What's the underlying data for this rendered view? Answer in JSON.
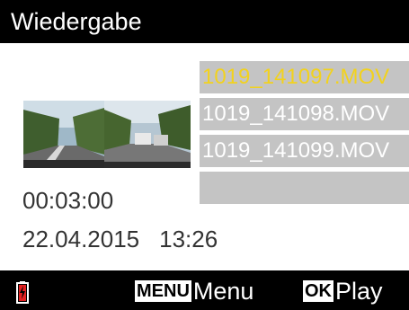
{
  "header": {
    "title": "Wiedergabe"
  },
  "files": [
    {
      "name": "1019_141097.MOV",
      "selected": true
    },
    {
      "name": "1019_141098.MOV",
      "selected": false
    },
    {
      "name": "1019_141099.MOV",
      "selected": false
    },
    {
      "name": "",
      "selected": false
    }
  ],
  "preview": {
    "thumbnail": "road-scene-thumbnail",
    "duration": "00:03:00",
    "date": "22.04.2015",
    "time": "13:26"
  },
  "footer": {
    "battery_icon": "battery-charging-icon",
    "menu_key": "MENU",
    "menu_label": "Menu",
    "ok_key": "OK",
    "ok_label": "Play"
  },
  "colors": {
    "selected_text": "#f2d21e",
    "list_bg": "#c4c4c4",
    "battery_red": "#e22020"
  }
}
